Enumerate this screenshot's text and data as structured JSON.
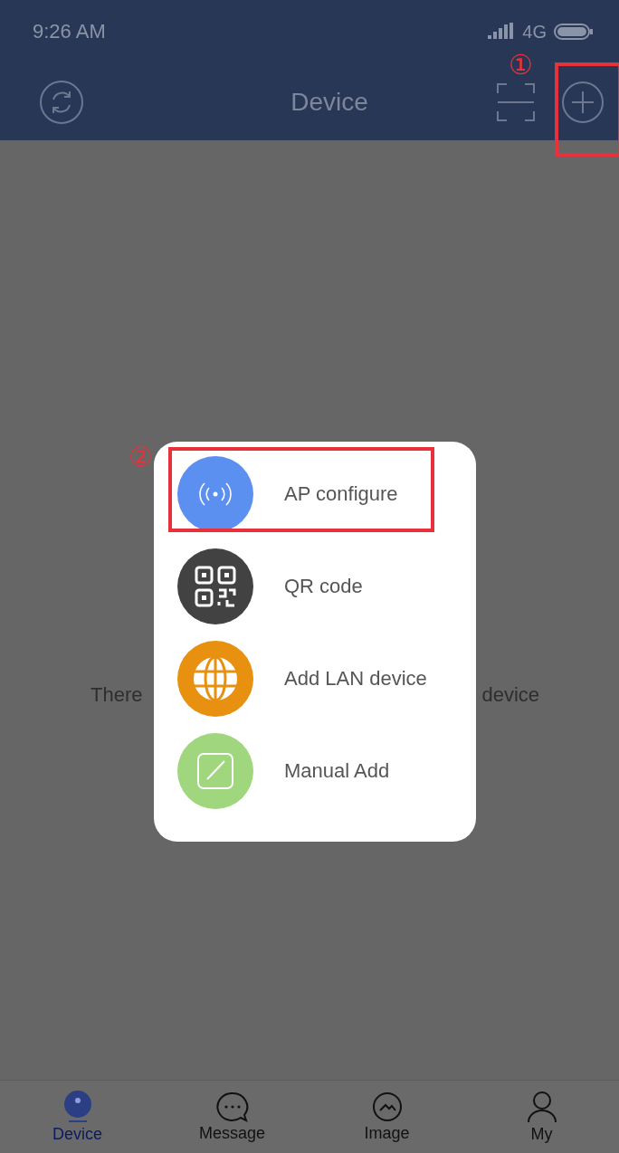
{
  "status_bar": {
    "time": "9:26 AM",
    "network": "4G"
  },
  "header": {
    "title": "Device",
    "add_annotation": "①"
  },
  "empty_message": {
    "left": "There",
    "right": "device"
  },
  "menu": {
    "items": [
      {
        "label": "AP configure",
        "kind": "wireless",
        "color": "#5b8ff0",
        "annotation": "②"
      },
      {
        "label": "QR code",
        "kind": "qr",
        "color": "#424242"
      },
      {
        "label": "Add LAN device",
        "kind": "globe",
        "color": "#e8900f"
      },
      {
        "label": "Manual Add",
        "kind": "edit",
        "color": "#9fd67e"
      }
    ]
  },
  "tabs": [
    {
      "label": "Device",
      "kind": "device",
      "selected": true
    },
    {
      "label": "Message",
      "kind": "message",
      "selected": false
    },
    {
      "label": "Image",
      "kind": "image",
      "selected": false
    },
    {
      "label": "My",
      "kind": "person",
      "selected": false
    }
  ]
}
